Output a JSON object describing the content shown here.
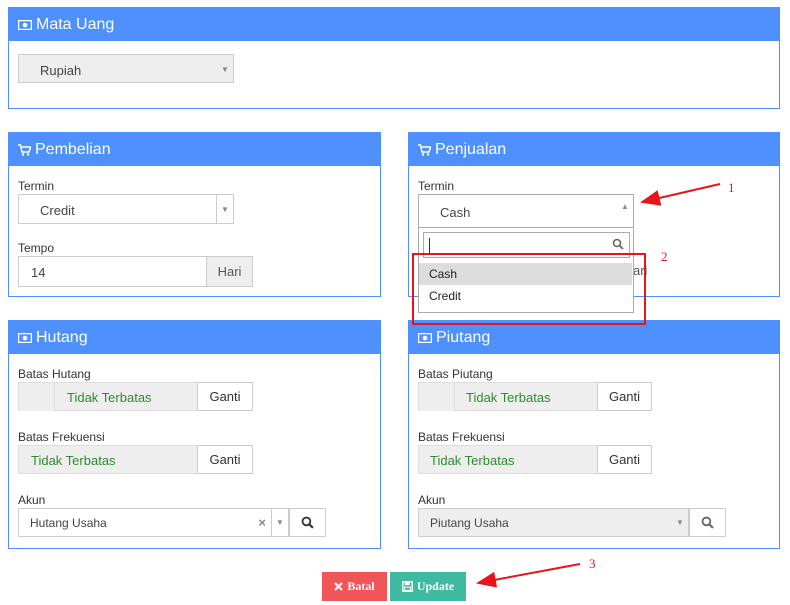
{
  "mata_uang": {
    "title": "Mata Uang",
    "currency_value": "Rupiah"
  },
  "pembelian": {
    "title": "Pembelian",
    "termin_label": "Termin",
    "termin_value": "Credit",
    "tempo_label": "Tempo",
    "tempo_value": "14",
    "tempo_unit": "Hari"
  },
  "penjualan": {
    "title": "Penjualan",
    "termin_label": "Termin",
    "termin_value": "Cash",
    "hidden_unit_fragment": "ari",
    "dropdown_search_value": "",
    "dropdown_options": [
      "Cash",
      "Credit"
    ]
  },
  "hutang": {
    "title": "Hutang",
    "batas_label": "Batas Hutang",
    "batas_value": "Tidak Terbatas",
    "batas_button": "Ganti",
    "frekuensi_label": "Batas Frekuensi",
    "frekuensi_value": "Tidak Terbatas",
    "frekuensi_button": "Ganti",
    "akun_label": "Akun",
    "akun_value": "Hutang Usaha"
  },
  "piutang": {
    "title": "Piutang",
    "batas_label": "Batas Piutang",
    "batas_value": "Tidak Terbatas",
    "batas_button": "Ganti",
    "frekuensi_label": "Batas Frekuensi",
    "frekuensi_value": "Tidak Terbatas",
    "frekuensi_button": "Ganti",
    "akun_label": "Akun",
    "akun_value": "Piutang Usaha"
  },
  "actions": {
    "cancel_label": "Batal",
    "update_label": "Update"
  },
  "annotations": [
    "1",
    "2",
    "3"
  ],
  "icons": {
    "panel_money": "money-icon",
    "panel_cart": "cart-icon",
    "search": "search-icon",
    "clear": "clear-icon",
    "cancel": "times-icon",
    "update": "save-icon"
  },
  "colors": {
    "panel_header": "#4d90fe",
    "success_text": "#2e8b2e",
    "cancel_button": "#f0555a",
    "update_button": "#3dbaa0",
    "annotation_red": "#e8131b"
  }
}
